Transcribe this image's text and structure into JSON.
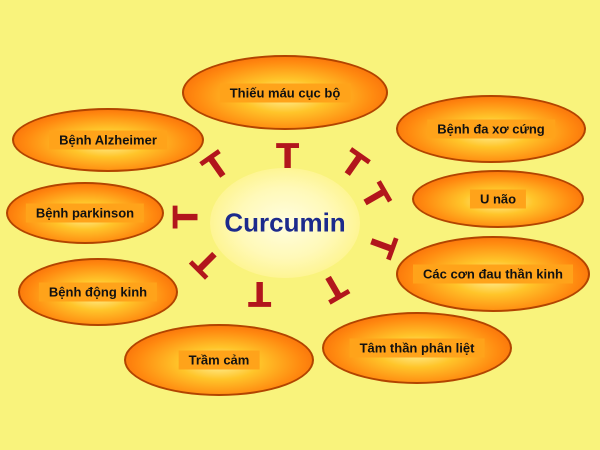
{
  "center_label": "Curcumin",
  "diseases": [
    "Thiếu máu cục bộ",
    "Bệnh Alzheimer",
    "Bệnh đa xơ cứng",
    "Bệnh parkinson",
    "U não",
    "Bệnh động kinh",
    "Các cơn đau thần kinh",
    "Trầm cảm",
    "Tâm thần phân liệt"
  ],
  "inhibit_symbol": "T",
  "colors": {
    "background": "#f9f37c",
    "oval_outer": "#f04b00",
    "oval_inner": "#ffc52a",
    "center_text": "#1c2a8c",
    "inhibitor": "#b2161c"
  }
}
